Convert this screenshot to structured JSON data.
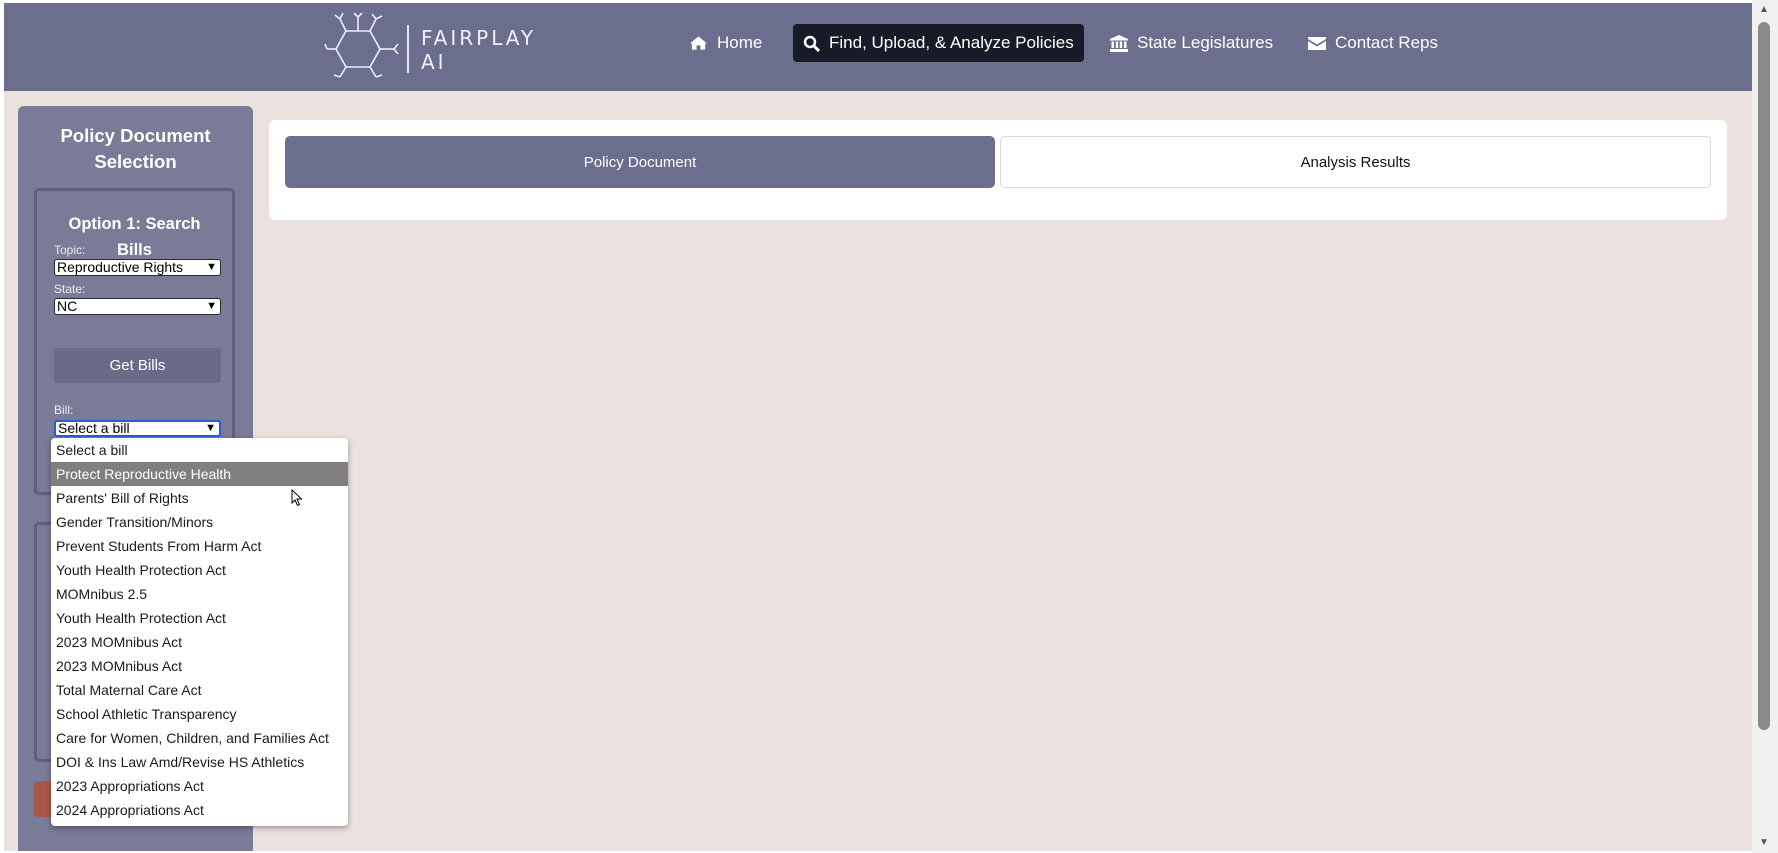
{
  "brand": {
    "line1": "FAIRPLAY",
    "line2": "AI"
  },
  "nav": {
    "home": "Home",
    "find": "Find, Upload, & Analyze Policies",
    "state": "State Legislatures",
    "contact": "Contact Reps"
  },
  "sidebar": {
    "title_line1": "Policy Document",
    "title_line2": "Selection",
    "option1_line1": "Option 1: Search",
    "option1_line2": "Bills",
    "topic_label": "Topic:",
    "topic_value": "Reproductive Rights",
    "state_label": "State:",
    "state_value": "NC",
    "get_bills": "Get Bills",
    "bill_label": "Bill:",
    "bill_value": "Select a bill"
  },
  "tabs": {
    "policy": "Policy Document",
    "analysis": "Analysis Results"
  },
  "bill_options": [
    "Select a bill",
    "Protect Reproductive Health",
    "Parents' Bill of Rights",
    "Gender Transition/Minors",
    "Prevent Students From Harm Act",
    "Youth Health Protection Act",
    "MOMnibus 2.5",
    "Youth Health Protection Act",
    "2023 MOMnibus Act",
    "2023 MOMnibus Act",
    "Total Maternal Care Act",
    "School Athletic Transparency",
    "Care for Women, Children, and Families Act",
    "DOI & Ins Law Amd/Revise HS Athletics",
    "2023 Appropriations Act",
    "2024 Appropriations Act"
  ],
  "icons": {
    "home": "home-icon",
    "find": "search-icon",
    "state": "bank-icon",
    "contact": "envelope-icon"
  },
  "colors": {
    "navbar": "#6c6e8d",
    "active_nav": "#171b28",
    "sidebar": "#7a7b97",
    "background": "#ebe2df",
    "hover_option": "#7f7f7f"
  }
}
